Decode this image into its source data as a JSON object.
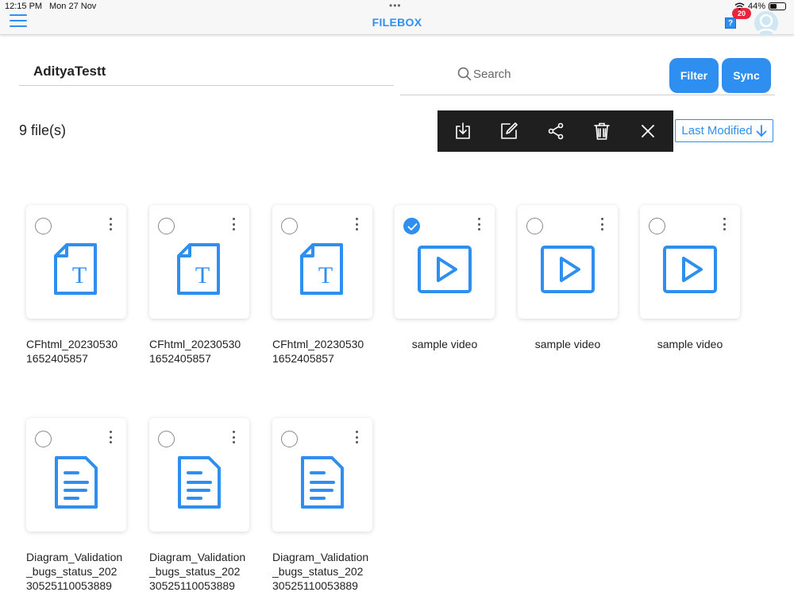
{
  "status_bar": {
    "time": "12:15 PM",
    "date": "Mon 27 Nov",
    "battery": "44%",
    "battery_level": 0.44
  },
  "header": {
    "title": "FILEBOX",
    "help_label": "?",
    "notification_count": "20",
    "accent_color": "#2f8ff0",
    "badge_color": "#e8233c"
  },
  "folder": {
    "name": "AdityaTestt"
  },
  "search": {
    "placeholder": "Search"
  },
  "buttons": {
    "filter": "Filter",
    "sync": "Sync"
  },
  "file_count": "9 file(s)",
  "toolbar": {
    "icons": [
      "download-icon",
      "edit-icon",
      "share-icon",
      "trash-icon",
      "close-icon"
    ]
  },
  "sort": {
    "label": "Last Modified"
  },
  "files": [
    {
      "name": "CFhtml_20230530\n1652405857",
      "type": "text",
      "icon": "text-file-icon",
      "selected": false
    },
    {
      "name": "CFhtml_20230530\n1652405857",
      "type": "text",
      "icon": "text-file-icon",
      "selected": false
    },
    {
      "name": "CFhtml_20230530\n1652405857",
      "type": "text",
      "icon": "text-file-icon",
      "selected": false
    },
    {
      "name": "sample video",
      "type": "video",
      "icon": "video-file-icon",
      "selected": true
    },
    {
      "name": "sample video",
      "type": "video",
      "icon": "video-file-icon",
      "selected": false
    },
    {
      "name": "sample video",
      "type": "video",
      "icon": "video-file-icon",
      "selected": false
    },
    {
      "name": "Diagram_Validation\n_bugs_status_202\n30525110053889",
      "type": "document",
      "icon": "document-file-icon",
      "selected": false
    },
    {
      "name": "Diagram_Validation\n_bugs_status_202\n30525110053889",
      "type": "document",
      "icon": "document-file-icon",
      "selected": false
    },
    {
      "name": "Diagram_Validation\n_bugs_status_202\n30525110053889",
      "type": "document",
      "icon": "document-file-icon",
      "selected": false
    }
  ]
}
